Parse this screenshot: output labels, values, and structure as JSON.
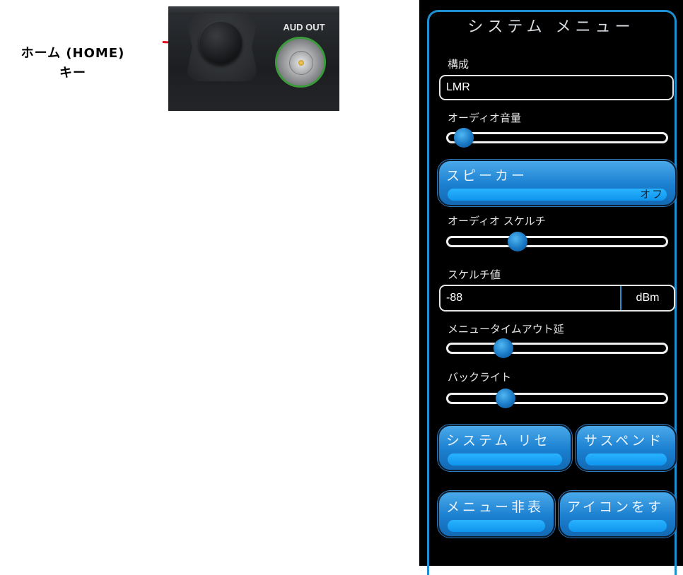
{
  "annotation": {
    "home_key_label_line1": "ホーム (HOME)",
    "home_key_label_line2": "キー",
    "pointer_color": "#e0101e"
  },
  "device": {
    "aud_out_label": "AUD OUT"
  },
  "menu": {
    "title": "システム メニュー",
    "config": {
      "label": "構成",
      "value": "LMR"
    },
    "audio_volume": {
      "label": "オーディオ音量",
      "level": 0.03
    },
    "speaker": {
      "label": "スピーカー",
      "state": "オフ"
    },
    "audio_squelch": {
      "label": "オーディオ スケルチ",
      "level": 0.3
    },
    "squelch_value": {
      "label": "スケルチ値",
      "value": "-88",
      "unit": "dBm"
    },
    "menu_timeout": {
      "label": "メニュータイムアウト延",
      "level": 0.23
    },
    "backlight": {
      "label": "バックライト",
      "level": 0.24
    },
    "buttons": {
      "system_reset": "システム リセ",
      "suspend": "サスペンド",
      "hide_menu": "メニュー非表",
      "all_icons": "アイコンをす"
    },
    "accent_color": "#1e8fd0"
  }
}
